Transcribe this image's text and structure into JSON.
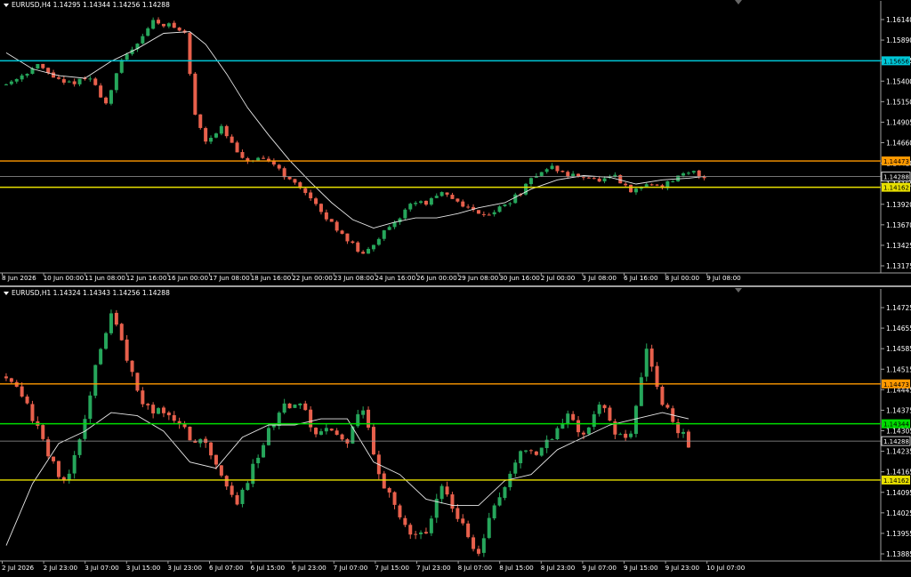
{
  "colors": {
    "background": "#000000",
    "frame": "#a0a0a0",
    "text": "#ffffff",
    "bull": "#26a65b",
    "bear": "#e8604c",
    "ma": "#e8e8e8",
    "current": "#9a9a9a"
  },
  "panels": [
    {
      "header": "EURUSD,H4  1.14295 1.14344 1.14256 1.14288",
      "ylim": [
        1.1315,
        1.1629
      ],
      "y_ticks": [
        "1.16140",
        "1.15890",
        "1.15645",
        "1.15400",
        "1.15150",
        "1.14905",
        "1.14660",
        "1.14410",
        "1.14165",
        "1.13920",
        "1.13670",
        "1.13425",
        "1.13175"
      ],
      "x_ticks": [
        "8 Jun 2026",
        "10 Jun 00:00",
        "11 Jun 08:00",
        "12 Jun 16:00",
        "16 Jun 00:00",
        "17 Jun 08:00",
        "18 Jun 16:00",
        "22 Jun 00:00",
        "23 Jun 08:00",
        "24 Jun 16:00",
        "26 Jun 00:00",
        "29 Jun 08:00",
        "30 Jun 16:00",
        "2 Jul 00:00",
        "3 Jul 08:00",
        "6 Jul 16:00",
        "8 Jul 00:00",
        "9 Jul 08:00"
      ],
      "hlines": [
        {
          "value": 1.15656,
          "label": "1.15656",
          "color": "#00c8d8"
        },
        {
          "value": 1.14473,
          "label": "1.14473",
          "color": "#ff9900"
        },
        {
          "value": 1.14162,
          "label": "1.14162",
          "color": "#e8e000"
        },
        {
          "value": 1.14288,
          "label": "1.14288",
          "color": "#9a9a9a",
          "current": true
        }
      ],
      "price_path": [
        [
          0,
          1.1538
        ],
        [
          6,
          1.156
        ],
        [
          11,
          1.1538
        ],
        [
          16,
          1.1545
        ],
        [
          19,
          1.1515
        ],
        [
          22,
          1.1565
        ],
        [
          25,
          1.1588
        ],
        [
          28,
          1.1612
        ],
        [
          31,
          1.1608
        ],
        [
          34,
          1.1598
        ],
        [
          36,
          1.1502
        ],
        [
          38,
          1.1472
        ],
        [
          41,
          1.1486
        ],
        [
          45,
          1.1448
        ],
        [
          48,
          1.1448
        ],
        [
          51,
          1.1445
        ],
        [
          54,
          1.1424
        ],
        [
          57,
          1.1412
        ],
        [
          60,
          1.1385
        ],
        [
          63,
          1.1368
        ],
        [
          66,
          1.1348
        ],
        [
          68,
          1.1335
        ],
        [
          71,
          1.1358
        ],
        [
          74,
          1.1372
        ],
        [
          77,
          1.1398
        ],
        [
          80,
          1.1398
        ],
        [
          83,
          1.1408
        ],
        [
          86,
          1.14
        ],
        [
          89,
          1.1388
        ],
        [
          92,
          1.1385
        ],
        [
          95,
          1.1395
        ],
        [
          98,
          1.141
        ],
        [
          101,
          1.1432
        ],
        [
          104,
          1.144
        ],
        [
          107,
          1.143
        ],
        [
          110,
          1.143
        ],
        [
          113,
          1.1423
        ],
        [
          116,
          1.1428
        ],
        [
          119,
          1.141
        ],
        [
          122,
          1.142
        ],
        [
          125,
          1.1418
        ],
        [
          128,
          1.1428
        ],
        [
          131,
          1.1434
        ],
        [
          133,
          1.1428
        ]
      ],
      "ma_path": [
        [
          0,
          1.1575
        ],
        [
          5,
          1.1556
        ],
        [
          10,
          1.1548
        ],
        [
          15,
          1.1545
        ],
        [
          20,
          1.1565
        ],
        [
          25,
          1.158
        ],
        [
          30,
          1.1598
        ],
        [
          35,
          1.16
        ],
        [
          38,
          1.1585
        ],
        [
          42,
          1.155
        ],
        [
          46,
          1.151
        ],
        [
          50,
          1.1478
        ],
        [
          54,
          1.1448
        ],
        [
          58,
          1.1422
        ],
        [
          62,
          1.1398
        ],
        [
          66,
          1.1378
        ],
        [
          70,
          1.1368
        ],
        [
          74,
          1.1375
        ],
        [
          78,
          1.138
        ],
        [
          82,
          1.138
        ],
        [
          86,
          1.1385
        ],
        [
          90,
          1.1392
        ],
        [
          95,
          1.1398
        ],
        [
          100,
          1.1414
        ],
        [
          105,
          1.1425
        ],
        [
          110,
          1.143
        ],
        [
          115,
          1.1428
        ],
        [
          120,
          1.142
        ],
        [
          125,
          1.1425
        ],
        [
          130,
          1.1427
        ],
        [
          133,
          1.1429
        ]
      ]
    },
    {
      "header": "EURUSD,H1  1.14324 1.14343 1.14256 1.14288",
      "ylim": [
        1.139,
        1.1476
      ],
      "y_ticks": [
        "1.14725",
        "1.14655",
        "1.14585",
        "1.14515",
        "1.14445",
        "1.14375",
        "1.14305",
        "1.14235",
        "1.14165",
        "1.14095",
        "1.14025",
        "1.13955",
        "1.13885"
      ],
      "x_ticks": [
        "2 Jul 2026",
        "2 Jul 23:00",
        "3 Jul 07:00",
        "3 Jul 15:00",
        "3 Jul 23:00",
        "6 Jul 07:00",
        "6 Jul 15:00",
        "6 Jul 23:00",
        "7 Jul 07:00",
        "7 Jul 15:00",
        "7 Jul 23:00",
        "8 Jul 07:00",
        "8 Jul 15:00",
        "8 Jul 23:00",
        "9 Jul 07:00",
        "9 Jul 15:00",
        "9 Jul 23:00",
        "10 Jul 07:00"
      ],
      "hlines": [
        {
          "value": 1.14473,
          "label": "1.14473",
          "color": "#ff9900"
        },
        {
          "value": 1.14344,
          "label": "1.14344",
          "color": "#00dd00"
        },
        {
          "value": 1.14162,
          "label": "1.14162",
          "color": "#e8e000"
        },
        {
          "value": 1.14288,
          "label": "1.14288",
          "color": "#9a9a9a",
          "current": true
        }
      ],
      "price_path": [
        [
          0,
          1.145
        ],
        [
          4,
          1.144
        ],
        [
          8,
          1.1425
        ],
        [
          11,
          1.1415
        ],
        [
          14,
          1.1428
        ],
        [
          17,
          1.1452
        ],
        [
          20,
          1.147
        ],
        [
          23,
          1.1455
        ],
        [
          26,
          1.144
        ],
        [
          29,
          1.1438
        ],
        [
          32,
          1.1436
        ],
        [
          35,
          1.143
        ],
        [
          38,
          1.1428
        ],
        [
          41,
          1.1418
        ],
        [
          44,
          1.1408
        ],
        [
          47,
          1.142
        ],
        [
          50,
          1.1432
        ],
        [
          53,
          1.144
        ],
        [
          56,
          1.144
        ],
        [
          59,
          1.1432
        ],
        [
          62,
          1.1432
        ],
        [
          65,
          1.1428
        ],
        [
          68,
          1.144
        ],
        [
          71,
          1.1418
        ],
        [
          74,
          1.1408
        ],
        [
          77,
          1.1398
        ],
        [
          80,
          1.14
        ],
        [
          83,
          1.1415
        ],
        [
          86,
          1.1405
        ],
        [
          88,
          1.1398
        ],
        [
          90,
          1.1392
        ],
        [
          92,
          1.1405
        ],
        [
          95,
          1.1415
        ],
        [
          98,
          1.1425
        ],
        [
          101,
          1.1425
        ],
        [
          104,
          1.143
        ],
        [
          107,
          1.1438
        ],
        [
          110,
          1.143
        ],
        [
          113,
          1.1442
        ],
        [
          116,
          1.143
        ],
        [
          119,
          1.1432
        ],
        [
          122,
          1.146
        ],
        [
          124,
          1.1445
        ],
        [
          127,
          1.1435
        ],
        [
          130,
          1.1428
        ]
      ],
      "ma_path": [
        [
          0,
          1.1395
        ],
        [
          5,
          1.1415
        ],
        [
          10,
          1.1428
        ],
        [
          15,
          1.1432
        ],
        [
          20,
          1.1438
        ],
        [
          25,
          1.1437
        ],
        [
          30,
          1.1432
        ],
        [
          35,
          1.1422
        ],
        [
          40,
          1.142
        ],
        [
          45,
          1.143
        ],
        [
          50,
          1.1434
        ],
        [
          55,
          1.1434
        ],
        [
          60,
          1.1436
        ],
        [
          65,
          1.1436
        ],
        [
          70,
          1.1422
        ],
        [
          75,
          1.1418
        ],
        [
          80,
          1.141
        ],
        [
          85,
          1.1408
        ],
        [
          90,
          1.1408
        ],
        [
          95,
          1.1416
        ],
        [
          100,
          1.1418
        ],
        [
          105,
          1.1426
        ],
        [
          110,
          1.143
        ],
        [
          115,
          1.1434
        ],
        [
          120,
          1.1436
        ],
        [
          125,
          1.1438
        ],
        [
          130,
          1.1436
        ]
      ]
    }
  ]
}
